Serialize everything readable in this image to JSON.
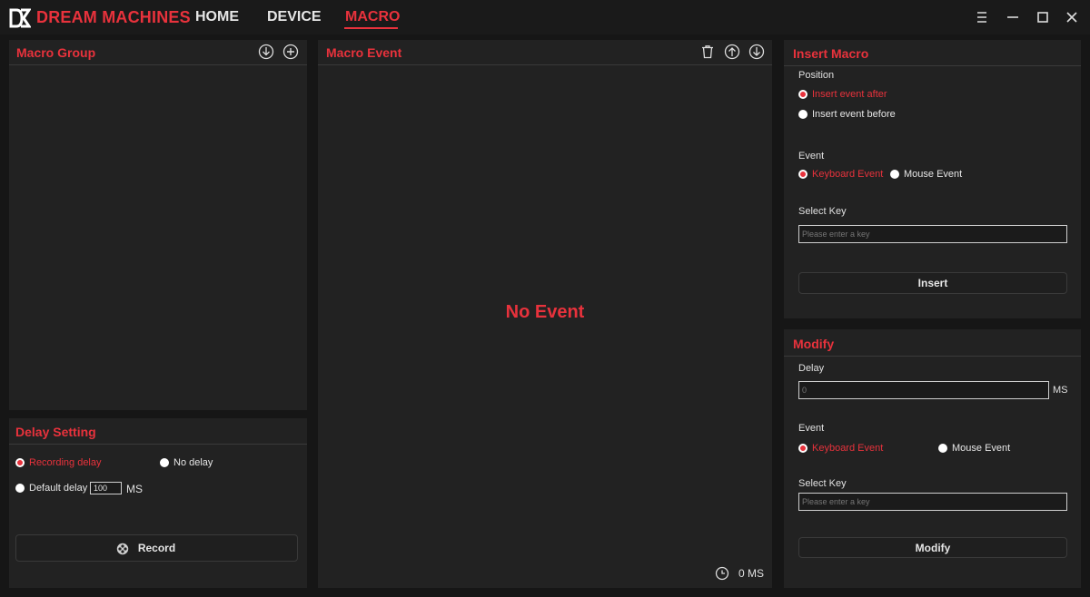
{
  "app": {
    "brand": "DREAM MACHINES",
    "tabs": [
      {
        "label": "HOME"
      },
      {
        "label": "DEVICE"
      },
      {
        "label": "MACRO"
      }
    ],
    "active_tab": "MACRO"
  },
  "macro_group": {
    "title": "Macro Group"
  },
  "delay_setting": {
    "title": "Delay Setting",
    "recording_delay": "Recording delay",
    "no_delay": "No delay",
    "default_delay": "Default delay",
    "default_delay_value": "100",
    "unit": "MS",
    "record_button": "Record"
  },
  "macro_event": {
    "title": "Macro Event",
    "empty_text": "No Event",
    "total_time": "0 MS"
  },
  "insert_macro": {
    "title": "Insert Macro",
    "position_label": "Position",
    "insert_after": "Insert event after",
    "insert_before": "Insert event before",
    "event_label": "Event",
    "keyboard_event": "Keyboard Event",
    "mouse_event": "Mouse Event",
    "select_key_label": "Select Key",
    "key_placeholder": "Please enter a key",
    "insert_button": "Insert"
  },
  "modify": {
    "title": "Modify",
    "delay_label": "Delay",
    "delay_placeholder": "0",
    "unit": "MS",
    "event_label": "Event",
    "keyboard_event": "Keyboard Event",
    "mouse_event": "Mouse Event",
    "select_key_label": "Select Key",
    "key_placeholder": "Please enter a key",
    "modify_button": "Modify"
  },
  "colors": {
    "accent": "#e8323c",
    "panel": "#222222",
    "background": "#161616"
  }
}
